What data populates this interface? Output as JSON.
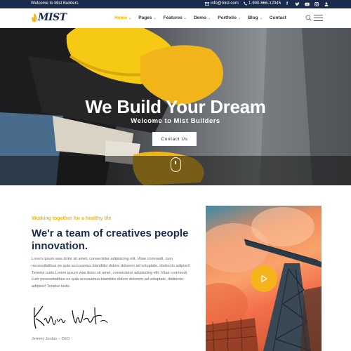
{
  "topbar": {
    "welcome": "Welcome to Mist Builders",
    "email": "info@mist.com",
    "phone": "1-900-666-12345",
    "socials": [
      "facebook-icon",
      "twitter-icon",
      "youtube-icon",
      "instagram-icon",
      "user-icon"
    ]
  },
  "nav": {
    "logo_text": "MIST",
    "items": [
      {
        "label": "Home",
        "caret": "⌄"
      },
      {
        "label": "Pages",
        "caret": "⌄"
      },
      {
        "label": "Features",
        "caret": "⌄"
      },
      {
        "label": "Demo",
        "caret": "⌄"
      },
      {
        "label": "Portfolio",
        "caret": "⌄"
      },
      {
        "label": "Blog",
        "caret": "⌄"
      },
      {
        "label": "Contact"
      }
    ]
  },
  "hero": {
    "title": "We Build Your Dream",
    "subtitle": "Welcome to Mist Builders",
    "cta": "Contact Us"
  },
  "about": {
    "tagline": "Working together for a healthy life",
    "heading": "We'r a team of creatives people innovation.",
    "paragraph": "Lorem ipsum was dolor sit amet, consectetur adipisicing elit. Vitae commodi, cum necessitatibus ex quia accusamus blanditiis dolore dolorem ad voluptate, distinctio adipisci! Tenetur iusto.Lorem ipsum was dolor sit amet, consectetur adipisicing elit. Vitae commodi, cum necessitatibus ex quia accusamus blanditiis dolore dolorem ad voluptate, distinctio adipisci! Tenetur iusto.",
    "author": "Jeremy Jordan – CEO"
  },
  "colors": {
    "accent": "#f4b41a",
    "navy": "#1b2b4d"
  }
}
